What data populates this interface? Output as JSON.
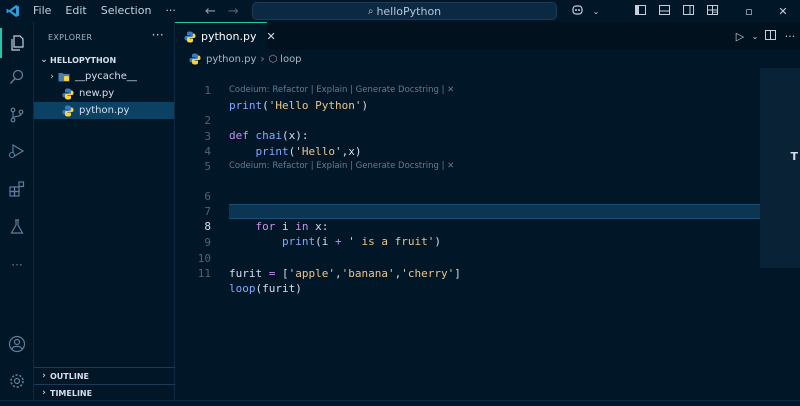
{
  "titlebar": {
    "menu": [
      "File",
      "Edit",
      "Selection",
      "···"
    ],
    "search_text": "helloPython"
  },
  "sidebar": {
    "header": "EXPLORER",
    "more": "···",
    "folder": "HELLOPYTHON",
    "items": [
      {
        "label": "__pycache__",
        "type": "folder"
      },
      {
        "label": "new.py",
        "type": "python"
      },
      {
        "label": "python.py",
        "type": "python",
        "selected": true
      }
    ],
    "outline": "OUTLINE",
    "timeline": "TIMELINE"
  },
  "editor": {
    "tab_label": "python.py",
    "breadcrumb": {
      "file": "python.py",
      "symbol": "loop"
    },
    "codelens_text": "Codeium: Refactor | Explain | Generate Docstring | ✕",
    "line_numbers": [
      "1",
      "2",
      "3",
      "4",
      "5",
      "6",
      "7",
      "8",
      "9",
      "10",
      "11"
    ],
    "active_line": 8
  },
  "colors": {
    "background": "#011627",
    "accent": "#21c7a8",
    "selection": "#0b4163",
    "keyword": "#c792ea",
    "function": "#82aaff",
    "string": "#ecc48d"
  }
}
